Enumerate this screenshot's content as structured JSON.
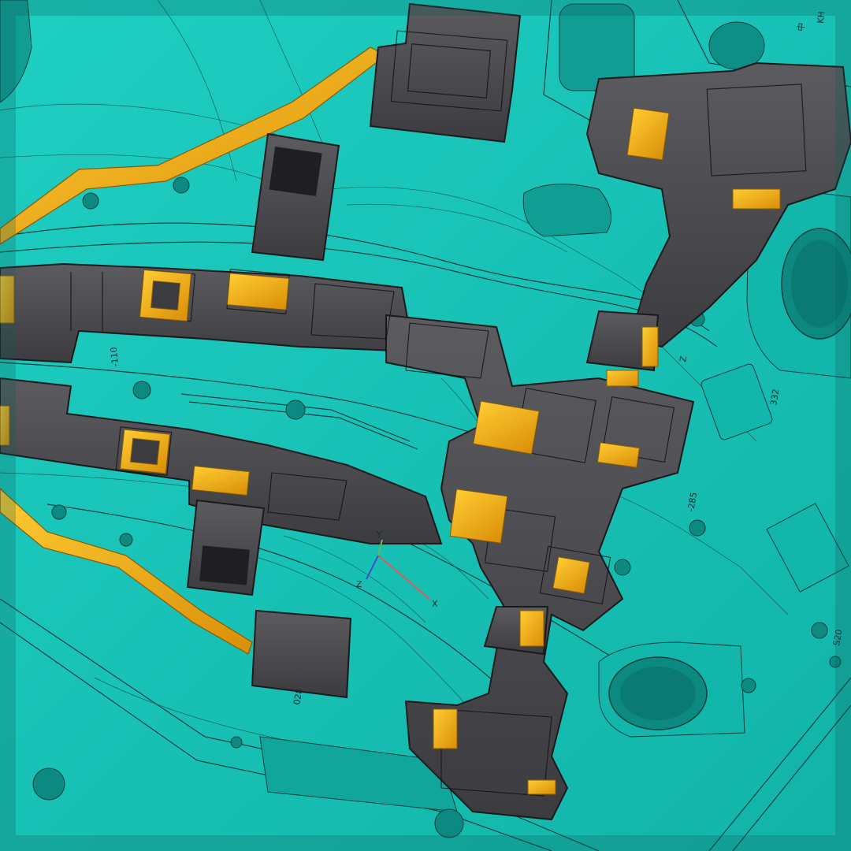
{
  "scene": {
    "colors": {
      "plate": "#16c9bd",
      "plate_dark": "#0f9d94",
      "line": "#0a3f3c",
      "part": "#4a4a4e",
      "part_edge": "#1a1a1c",
      "accent": "#f2b21a",
      "accent_dark": "#b97a0a"
    },
    "labels": {
      "dim_a": "-110",
      "dim_b": "-285",
      "dim_c": "Z",
      "stamp_1": "KH",
      "stamp_2": "中",
      "mark_1": "332",
      "mark_2": "S20",
      "mark_3": "028"
    },
    "axis_triad": {
      "x": "X",
      "y": "Y",
      "z": "Z"
    }
  }
}
